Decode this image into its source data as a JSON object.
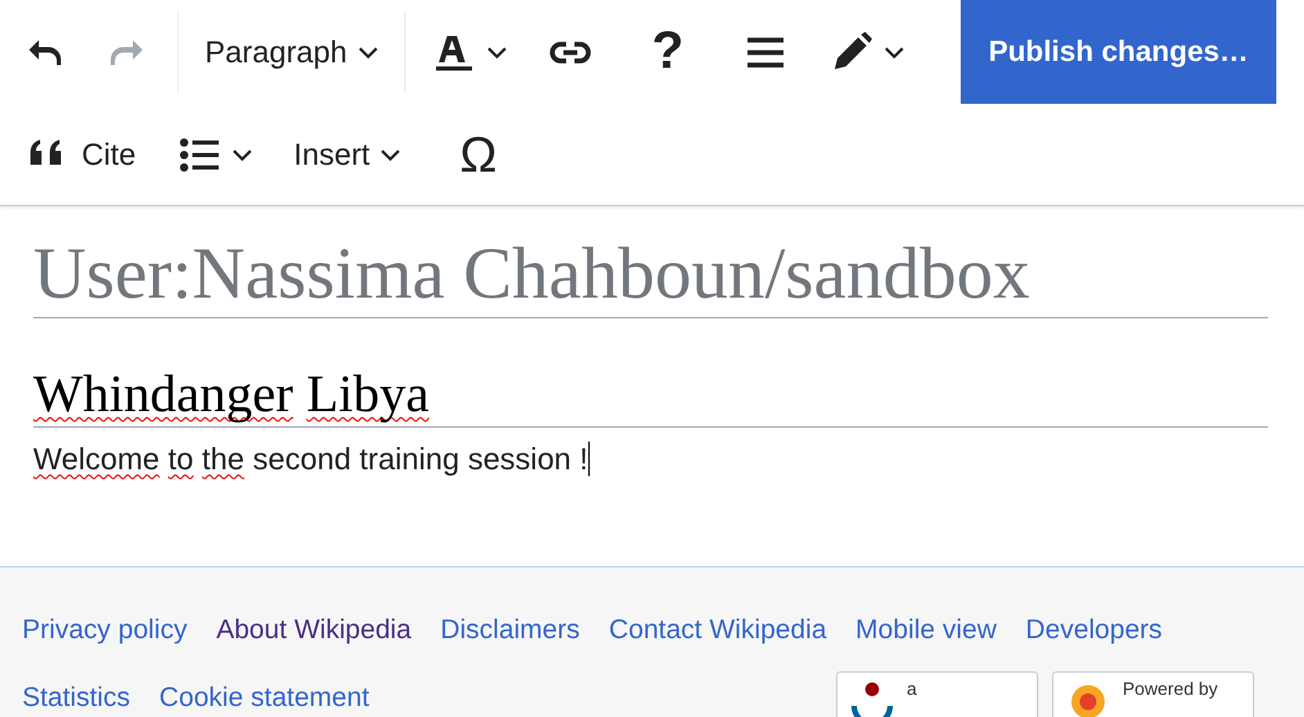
{
  "toolbar": {
    "primary": [
      {
        "kind": "undo",
        "disabled": false
      },
      {
        "kind": "redo",
        "disabled": true
      },
      {
        "kind": "separator"
      },
      {
        "kind": "dropdown",
        "label": "Paragraph"
      },
      {
        "kind": "separator"
      },
      {
        "kind": "textstyle",
        "caret": true
      },
      {
        "kind": "link"
      },
      {
        "kind": "glyph",
        "label": "?"
      },
      {
        "kind": "menu"
      },
      {
        "kind": "edit",
        "caret": true
      }
    ],
    "secondary": [
      {
        "kind": "cite",
        "label": "Cite"
      },
      {
        "kind": "list",
        "caret": true
      },
      {
        "kind": "dropdown",
        "label": "Insert"
      },
      {
        "kind": "glyph",
        "label": "Ω"
      }
    ],
    "publish": "Publish changes…"
  },
  "page": {
    "title": "User:Nassima Chahboun/sandbox",
    "heading": [
      {
        "text": "Whindanger",
        "misspelled": true
      },
      {
        "text": "Libya",
        "misspelled": true
      }
    ],
    "paragraph": [
      {
        "text": "Welcome",
        "misspelled": true
      },
      {
        "text": "to",
        "misspelled": true
      },
      {
        "text": "the",
        "misspelled": true
      },
      {
        "text": "second training session !",
        "misspelled": false
      }
    ],
    "cursor": true
  },
  "footer": {
    "links": [
      [
        {
          "label": "Privacy policy",
          "visited": false
        },
        {
          "label": "About Wikipedia",
          "visited": true
        },
        {
          "label": "Disclaimers",
          "visited": false
        },
        {
          "label": "Contact Wikipedia",
          "visited": false
        },
        {
          "label": "Mobile view",
          "visited": false
        },
        {
          "label": "Developers",
          "visited": false
        }
      ],
      [
        {
          "label": "Statistics",
          "visited": false
        },
        {
          "label": "Cookie statement",
          "visited": false
        }
      ]
    ],
    "badges": [
      {
        "kind": "wikimedia",
        "label": "a"
      },
      {
        "kind": "mediawiki",
        "label": "Powered by"
      }
    ]
  }
}
